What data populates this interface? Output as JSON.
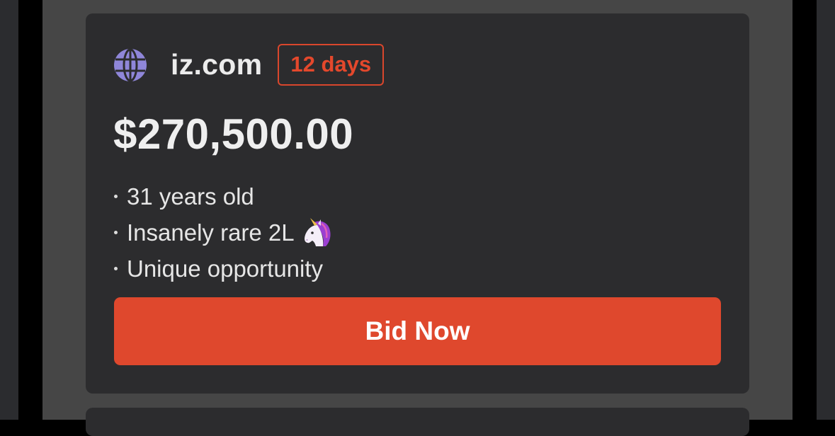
{
  "listing": {
    "domain": "iz.com",
    "time_left": "12 days",
    "price": "$270,500.00",
    "features": [
      {
        "text": "31 years old"
      },
      {
        "text": "Insanely rare 2L",
        "icon": "unicorn-icon"
      },
      {
        "text": "Unique opportunity"
      }
    ],
    "bid_label": "Bid Now",
    "icon": "globe-icon"
  },
  "colors": {
    "accent": "#df482d",
    "card_bg": "#2c2c2e",
    "page_bg": "#464646",
    "globe": "#8f86d9"
  }
}
